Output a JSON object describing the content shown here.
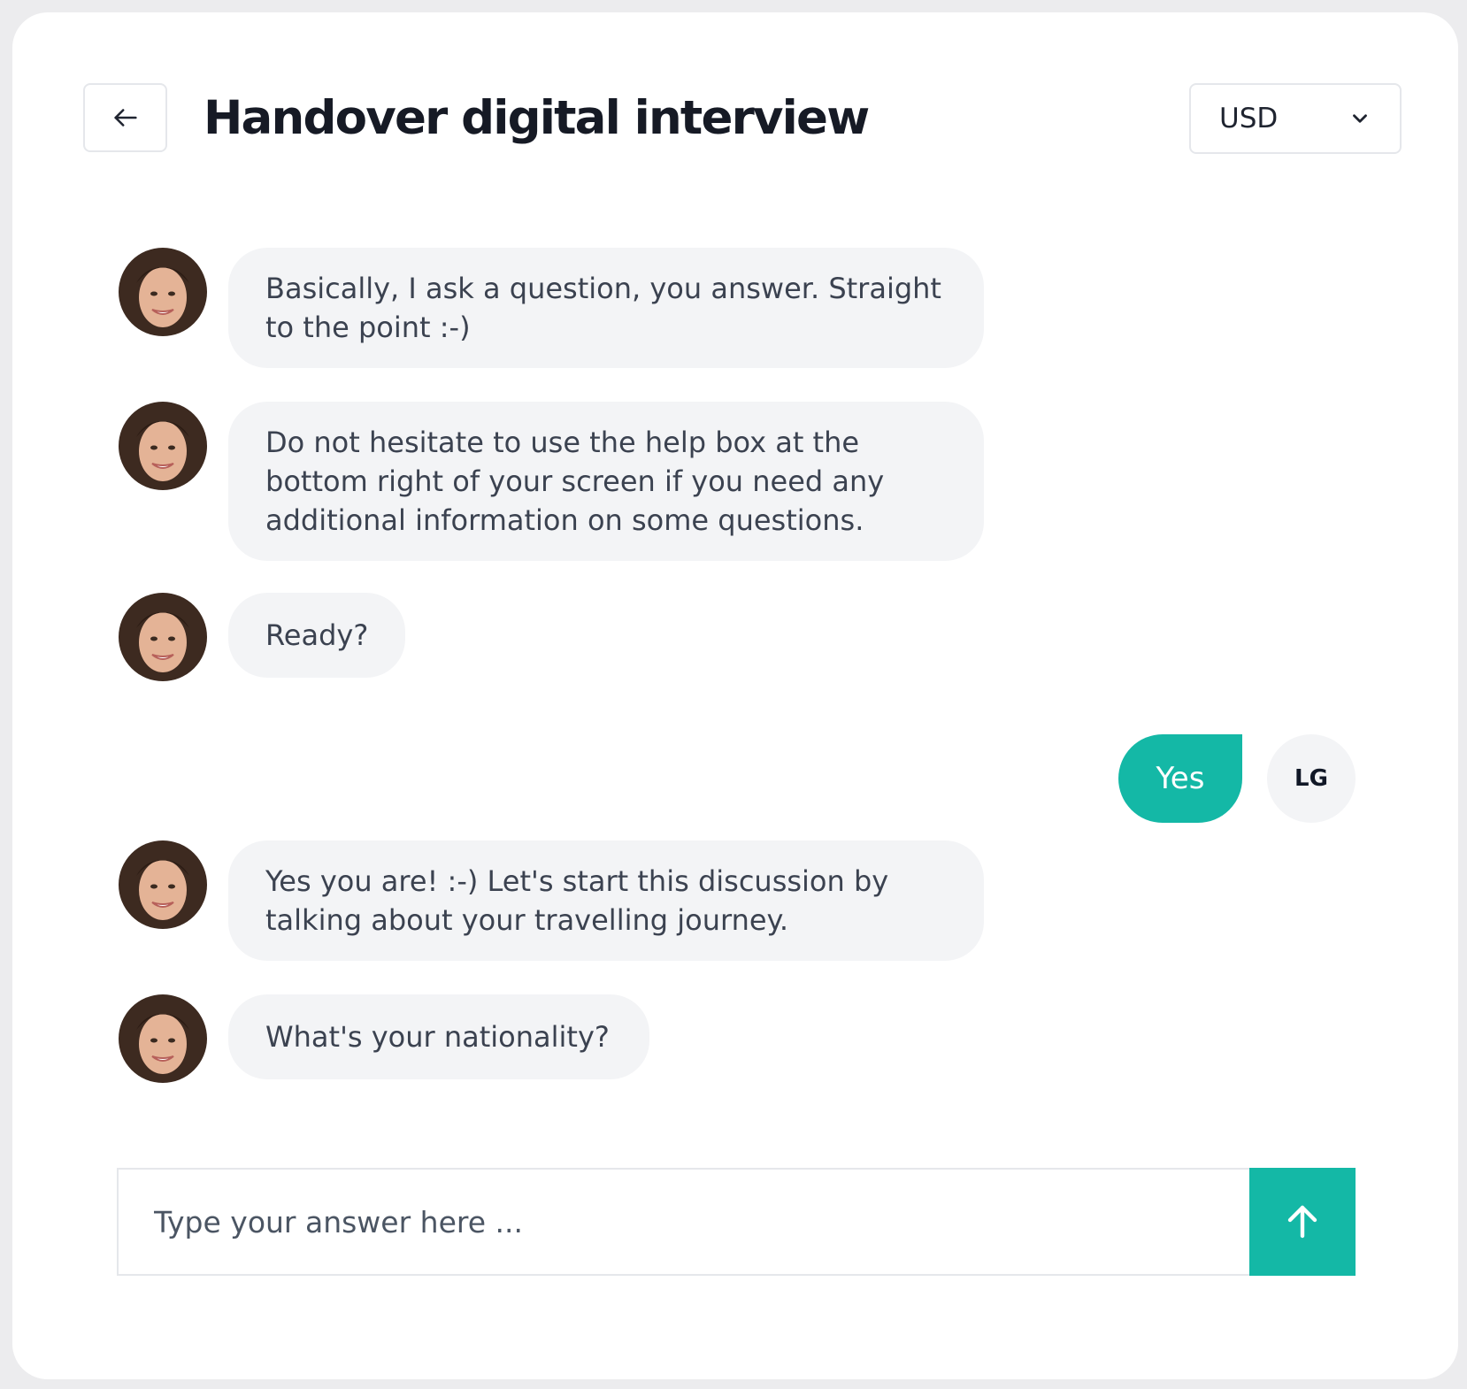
{
  "header": {
    "back_icon": "arrow-left-icon",
    "title": "Handover digital interview",
    "currency": {
      "selected": "USD",
      "icon": "chevron-down-icon"
    }
  },
  "messages": [
    {
      "from": "bot",
      "avatar_icon": "bot-avatar-photo",
      "text": "Basically, I ask a question, you answer. Straight to the point :-)"
    },
    {
      "from": "bot",
      "avatar_icon": "bot-avatar-photo",
      "text": "Do not hesitate to use the help box at the bottom right of your screen if you need any additional information on some questions."
    },
    {
      "from": "bot",
      "avatar_icon": "bot-avatar-photo",
      "text": "Ready?"
    },
    {
      "from": "user",
      "text": "Yes",
      "initials": "LG"
    },
    {
      "from": "bot",
      "avatar_icon": "bot-avatar-photo",
      "text": "Yes you are! :-) Let's start this discussion by talking about your travelling journey."
    },
    {
      "from": "bot",
      "avatar_icon": "bot-avatar-photo",
      "text": "What's your nationality?"
    }
  ],
  "composer": {
    "placeholder": "Type your answer here ...",
    "value": "",
    "send_icon": "arrow-up-icon"
  },
  "colors": {
    "accent": "#14b8a6",
    "bubble_bg": "#f3f4f6",
    "title": "#161a25",
    "page_bg": "#ececee"
  }
}
